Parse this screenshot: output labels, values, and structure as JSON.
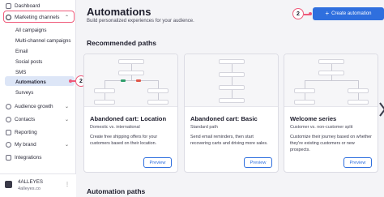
{
  "sidebar": {
    "dashboard": "Dashboard",
    "marketing_channels": "Marketing channels",
    "sub_items": [
      "All campaigns",
      "Multi-channel campaigns",
      "Email",
      "Social posts",
      "SMS",
      "Automations",
      "Surveys"
    ],
    "audience_growth": "Audience growth",
    "contacts": "Contacts",
    "reporting": "Reporting",
    "my_brand": "My brand",
    "integrations": "Integrations",
    "account_name": "4ALLEYES",
    "account_domain": "4alleyes.co"
  },
  "header": {
    "title": "Automations",
    "subtitle": "Build personalized experiences for your audience.",
    "create_button": "Create automation",
    "badge_number": "2"
  },
  "sections": {
    "recommended": "Recommended paths",
    "automation_paths": "Automation paths"
  },
  "cards": [
    {
      "title": "Abandoned cart: Location",
      "tag": "Domestic vs. international",
      "description": "Create free shipping offers for your customers based on their location.",
      "button": "Preview"
    },
    {
      "title": "Abandoned cart: Basic",
      "tag": "Standard path",
      "description": "Send email reminders, then start recovering carts and driving more sales.",
      "button": "Preview"
    },
    {
      "title": "Welcome series",
      "tag": "Customer vs. non-customer split",
      "description": "Customize their journey based on whether they're existing customers or new prospects.",
      "button": "Preview"
    }
  ],
  "colors": {
    "accent_blue": "#2f6fde",
    "highlight_pink": "#ef5a7a",
    "active_bg": "#dde6f7"
  }
}
